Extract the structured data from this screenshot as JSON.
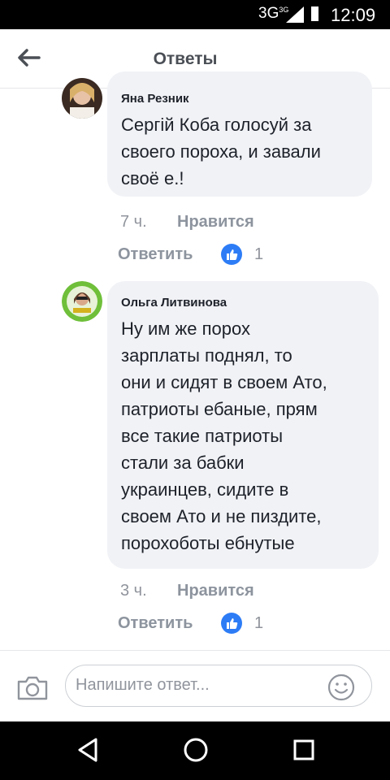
{
  "status": {
    "network": "3G",
    "network_sup": "3G",
    "time": "12:09"
  },
  "header": {
    "title": "Ответы"
  },
  "comments": [
    {
      "author": "Яна Резник",
      "lines": [
        "Сергій Коба голосуй за",
        "своего пороха, и завали",
        "своё е.!"
      ],
      "time": "7 ч.",
      "like_label": "Нравится",
      "reply_label": "Ответить",
      "reactions": "1"
    },
    {
      "author": "Ольга Литвинова",
      "lines": [
        "Ну им же порох",
        "зарплаты поднял, то",
        "они и сидят в своем Ато,",
        "патриоты ебаные, прям",
        "все такие патриоты",
        "стали за бабки",
        "украинцев, сидите в",
        "своем Ато и не пиздите,",
        "порохоботы ебнутые"
      ],
      "time": "3 ч.",
      "like_label": "Нравится",
      "reply_label": "Ответить",
      "reactions": "1"
    }
  ],
  "composer": {
    "placeholder": "Напишите ответ..."
  },
  "colors": {
    "like_blue": "#2d7cf6",
    "bubble": "#f1f2f6",
    "meta_gray": "#90949c"
  }
}
